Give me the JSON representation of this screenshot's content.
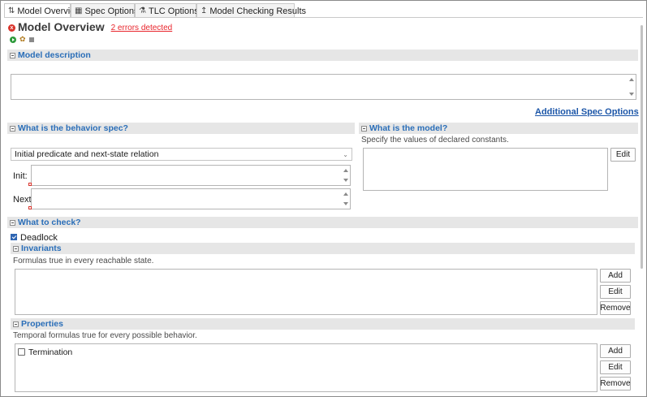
{
  "tabs": [
    {
      "label": "Model Overview",
      "icon": "overview-icon",
      "glyph": "⇅"
    },
    {
      "label": "Spec Options",
      "icon": "spec-options-icon",
      "glyph": "▦"
    },
    {
      "label": "TLC Options",
      "icon": "tlc-options-icon",
      "glyph": "⚗"
    },
    {
      "label": "Model Checking Results",
      "icon": "results-icon",
      "glyph": "↥"
    }
  ],
  "header": {
    "title": "Model Overview",
    "errors_link": "2 errors detected",
    "error_icon": "x"
  },
  "toolbar": {
    "run": "run-icon",
    "config": "config-icon",
    "stop": "stop-icon"
  },
  "model_description": {
    "title": "Model description",
    "value": ""
  },
  "additional_spec_options": "Additional Spec Options",
  "behavior": {
    "title": "What is the behavior spec?",
    "selected": "Initial predicate and next-state relation",
    "init_label": "Init:",
    "next_label": "Next:",
    "init_value": "",
    "next_value": ""
  },
  "model": {
    "title": "What is the model?",
    "description": "Specify the values of declared constants.",
    "edit_label": "Edit"
  },
  "check": {
    "title": "What to check?",
    "deadlock_label": "Deadlock",
    "deadlock_checked": true,
    "invariants": {
      "title": "Invariants",
      "description": "Formulas true in every reachable state.",
      "add": "Add",
      "edit": "Edit",
      "remove": "Remove"
    },
    "properties": {
      "title": "Properties",
      "description": "Temporal formulas true for every possible behavior.",
      "items": [
        {
          "label": "Termination",
          "checked": false
        }
      ],
      "add": "Add",
      "edit": "Edit",
      "remove": "Remove"
    }
  },
  "colors": {
    "section_title": "#2a6eb8",
    "link": "#1c56a8",
    "error": "#e8242b",
    "section_bar": "#e6e6e6"
  }
}
